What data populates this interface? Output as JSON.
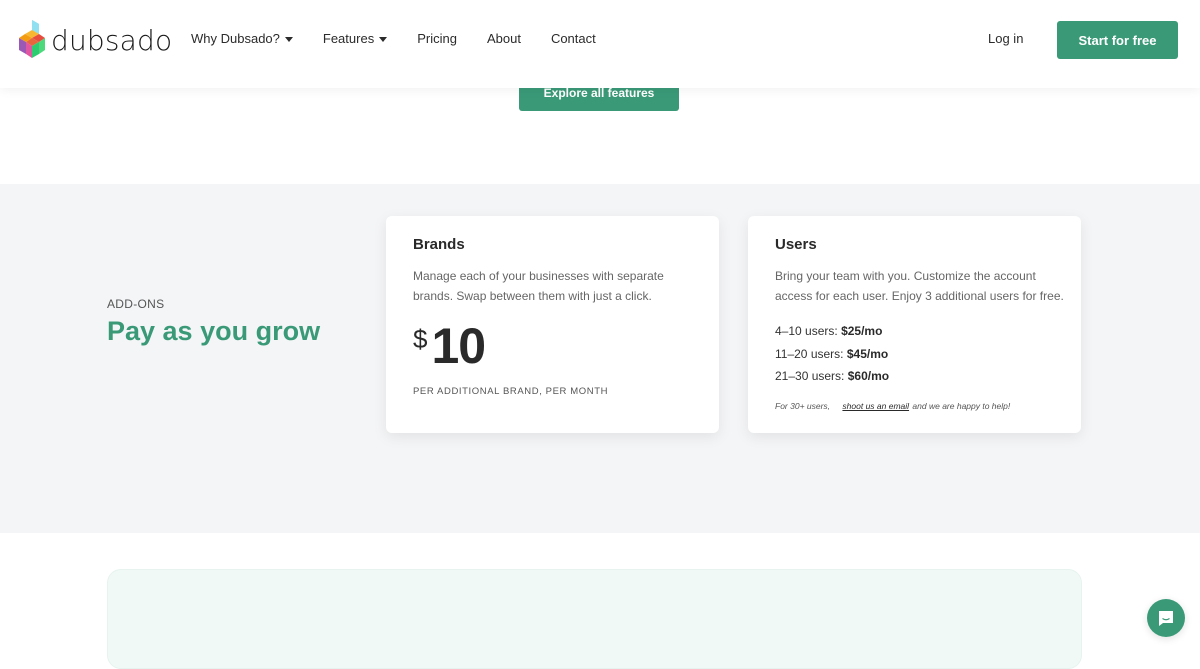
{
  "header": {
    "logo_text": "dubsado",
    "nav": [
      {
        "label": "Why Dubsado?",
        "has_dropdown": true
      },
      {
        "label": "Features",
        "has_dropdown": true
      },
      {
        "label": "Pricing",
        "has_dropdown": false
      },
      {
        "label": "About",
        "has_dropdown": false
      },
      {
        "label": "Contact",
        "has_dropdown": false
      }
    ],
    "login_label": "Log in",
    "cta_label": "Start for free"
  },
  "explore_button_label": "Explore all features",
  "addons": {
    "eyebrow": "ADD-ONS",
    "headline": "Pay as you grow",
    "brands": {
      "title": "Brands",
      "description": "Manage each of your businesses with separate brands. Swap between them with just a click.",
      "currency": "$",
      "amount": "10",
      "note": "PER ADDITIONAL BRAND, PER MONTH"
    },
    "users": {
      "title": "Users",
      "description": "Bring your team with you. Customize the account access for each user. Enjoy 3 additional users for free.",
      "tiers": [
        {
          "range": "4–10 users:",
          "price": "$25/mo"
        },
        {
          "range": "11–20 users:",
          "price": "$45/mo"
        },
        {
          "range": "21–30 users:",
          "price": "$60/mo"
        }
      ],
      "footnote_prefix": "For 30+ users,",
      "footnote_link": "shoot us an email",
      "footnote_suffix": "and we are happy to help!"
    }
  },
  "colors": {
    "brand_green": "#3a9a78",
    "section_bg": "#f4f5f7",
    "mint_panel": "#f0f9f6"
  },
  "chat_widget": {
    "icon": "chat-bubble-icon"
  }
}
